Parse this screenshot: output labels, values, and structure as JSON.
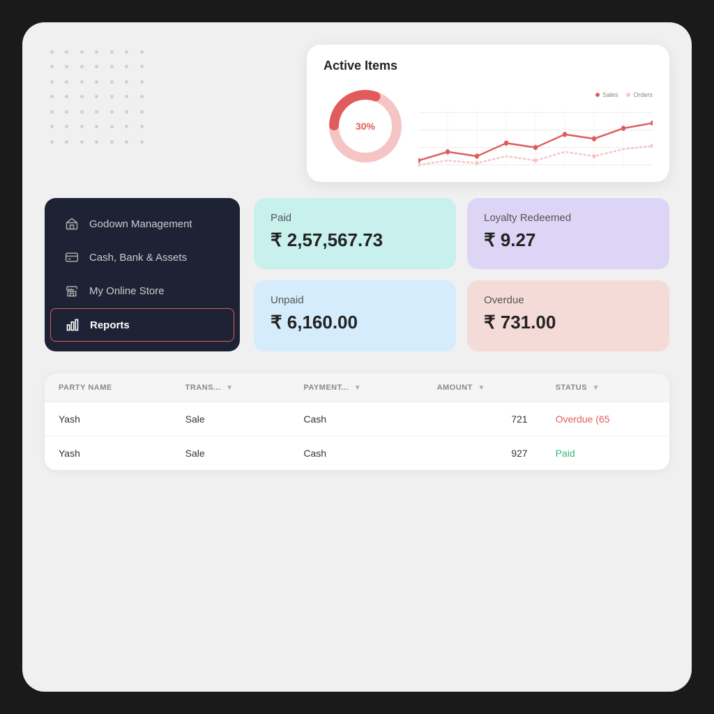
{
  "activeItems": {
    "title": "Active Items",
    "donut": {
      "percent": "30%",
      "filled": 30,
      "empty": 70,
      "colorFilled": "#e05c5c",
      "colorEmpty": "#f5c5c5"
    },
    "legend": [
      {
        "label": "Sales",
        "color": "#e05c5c"
      },
      {
        "label": "Orders",
        "color": "#f5c5c5"
      }
    ]
  },
  "sidebar": {
    "items": [
      {
        "id": "godown",
        "icon": "🏛",
        "label": "Godown Management",
        "active": false
      },
      {
        "id": "cash",
        "icon": "🏦",
        "label": "Cash, Bank & Assets",
        "active": false
      },
      {
        "id": "store",
        "icon": "🏪",
        "label": "My Online Store",
        "active": false
      },
      {
        "id": "reports",
        "icon": "📊",
        "label": "Reports",
        "active": true
      }
    ]
  },
  "stats": [
    {
      "id": "paid",
      "label": "Paid",
      "value": "₹ 2,57,567.73",
      "class": "paid"
    },
    {
      "id": "loyalty",
      "label": "Loyalty Redeemed",
      "value": "₹ 9.27",
      "class": "loyalty"
    },
    {
      "id": "unpaid",
      "label": "Unpaid",
      "value": "₹ 6,160.00",
      "class": "unpaid"
    },
    {
      "id": "overdue",
      "label": "Overdue",
      "value": "₹ 731.00",
      "class": "overdue"
    }
  ],
  "table": {
    "columns": [
      {
        "id": "party",
        "label": "PARTY NAME",
        "filterable": true
      },
      {
        "id": "trans",
        "label": "TRANS...",
        "filterable": true
      },
      {
        "id": "payment",
        "label": "PAYMENT...",
        "filterable": true
      },
      {
        "id": "amount",
        "label": "AMOUNT",
        "filterable": true
      },
      {
        "id": "status",
        "label": "STATUS",
        "filterable": true
      }
    ],
    "rows": [
      {
        "party": "Yash",
        "trans": "Sale",
        "payment": "Cash",
        "amount": "721",
        "status": "Overdue (65",
        "statusClass": "overdue"
      },
      {
        "party": "Yash",
        "trans": "Sale",
        "payment": "Cash",
        "amount": "927",
        "status": "Paid",
        "statusClass": "paid"
      }
    ]
  }
}
